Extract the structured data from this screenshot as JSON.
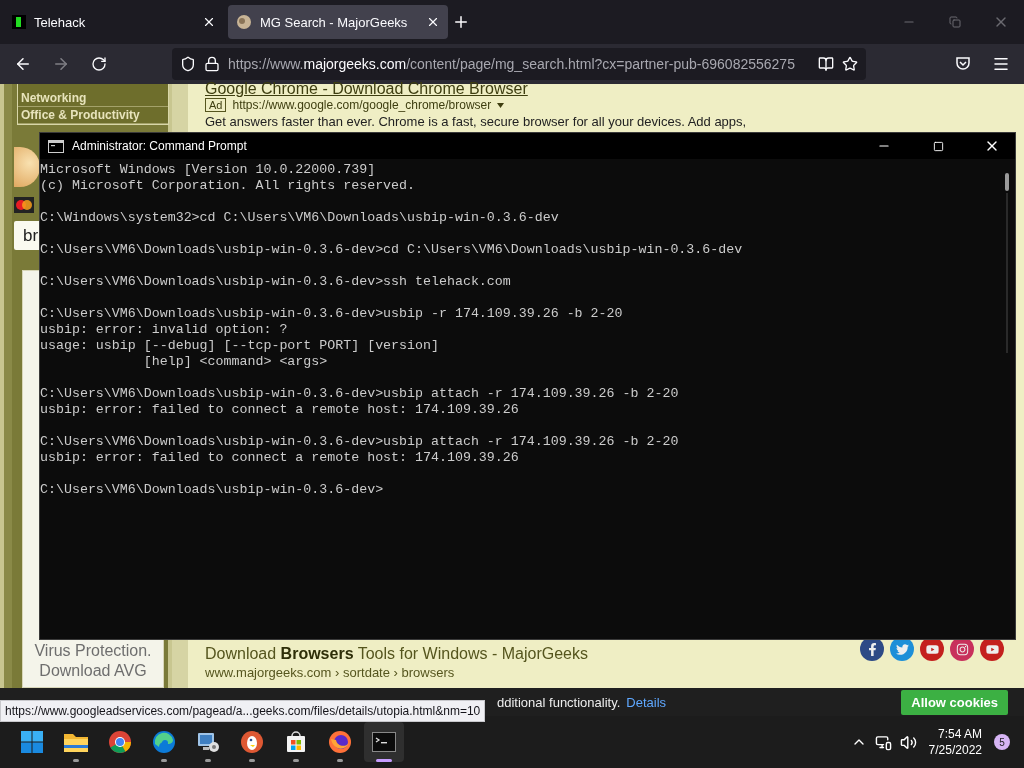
{
  "browser": {
    "tabs": [
      {
        "label": "Telehack",
        "kind": "terminal",
        "selected": false
      },
      {
        "label": "MG Search - MajorGeeks",
        "kind": "site",
        "selected": true
      }
    ],
    "address": "https://www.**majorgeeks.com**/content/page/mg_search.html?cx=partner-pub-696082556275",
    "forward_disabled": true
  },
  "sidebar": {
    "categories": [
      "Networking",
      "Office & Productivity"
    ],
    "search_value": "br",
    "ad_lines": [
      "Virus Protection.",
      "Download AVG"
    ]
  },
  "results": [
    {
      "title": "Google Chrome - Download Chrome Browser",
      "ad": "Ad",
      "url": "https://www.google.com/google_chrome/browser",
      "description": "Get answers faster than ever. Chrome is a fast, secure browser for all your devices. Add apps,"
    },
    {
      "title": "Download **Browsers** Tools for Windows - MajorGeeks",
      "url": "www.majorgeeks.com › sortdate › browsers"
    }
  ],
  "social_links": [
    {
      "kind": "facebook"
    },
    {
      "kind": "twitter"
    },
    {
      "kind": "youtube"
    },
    {
      "kind": "instagram"
    },
    {
      "kind": "youtube"
    }
  ],
  "cookie_bar": {
    "text": "dditional functionality.",
    "link": "Details",
    "button": "Allow cookies"
  },
  "status_url": "https://www.googleadservices.com/pagead/a...geeks.com/files/details/utopia.html&nm=10",
  "console": {
    "title": "Administrator: Command Prompt",
    "blocks": [
      [
        "Microsoft Windows [Version 10.0.22000.739]",
        "(c) Microsoft Corporation. All rights reserved."
      ],
      [
        "C:\\Windows\\system32>cd C:\\Users\\VM6\\Downloads\\usbip-win-0.3.6-dev"
      ],
      [
        "C:\\Users\\VM6\\Downloads\\usbip-win-0.3.6-dev>cd C:\\Users\\VM6\\Downloads\\usbip-win-0.3.6-dev"
      ],
      [
        "C:\\Users\\VM6\\Downloads\\usbip-win-0.3.6-dev>ssh telehack.com"
      ],
      [
        "C:\\Users\\VM6\\Downloads\\usbip-win-0.3.6-dev>usbip -r 174.109.39.26 -b 2-20",
        "usbip: error: invalid option: ?",
        "usage: usbip [--debug] [--tcp-port PORT] [version]",
        "             [help] <command> <args>"
      ],
      [
        "C:\\Users\\VM6\\Downloads\\usbip-win-0.3.6-dev>usbip attach -r 174.109.39.26 -b 2-20",
        "usbip: error: failed to connect a remote host: 174.109.39.26"
      ],
      [
        "C:\\Users\\VM6\\Downloads\\usbip-win-0.3.6-dev>usbip attach -r 174.109.39.26 -b 2-20",
        "usbip: error: failed to connect a remote host: 174.109.39.26"
      ],
      [
        "C:\\Users\\VM6\\Downloads\\usbip-win-0.3.6-dev>"
      ]
    ]
  },
  "taskbar": {
    "apps": [
      {
        "kind": "files",
        "running": true,
        "selected": false
      },
      {
        "kind": "chrome",
        "running": false,
        "selected": false
      },
      {
        "kind": "edge",
        "running": true,
        "selected": false
      },
      {
        "kind": "control",
        "running": true,
        "selected": false
      },
      {
        "kind": "duck",
        "running": true,
        "selected": false
      },
      {
        "kind": "store",
        "running": true,
        "selected": false
      },
      {
        "kind": "firefox",
        "running": true,
        "selected": false
      },
      {
        "kind": "terminal",
        "running": true,
        "selected": true
      }
    ],
    "time": "7:54 AM",
    "date": "7/25/2022",
    "notifications": "5"
  }
}
